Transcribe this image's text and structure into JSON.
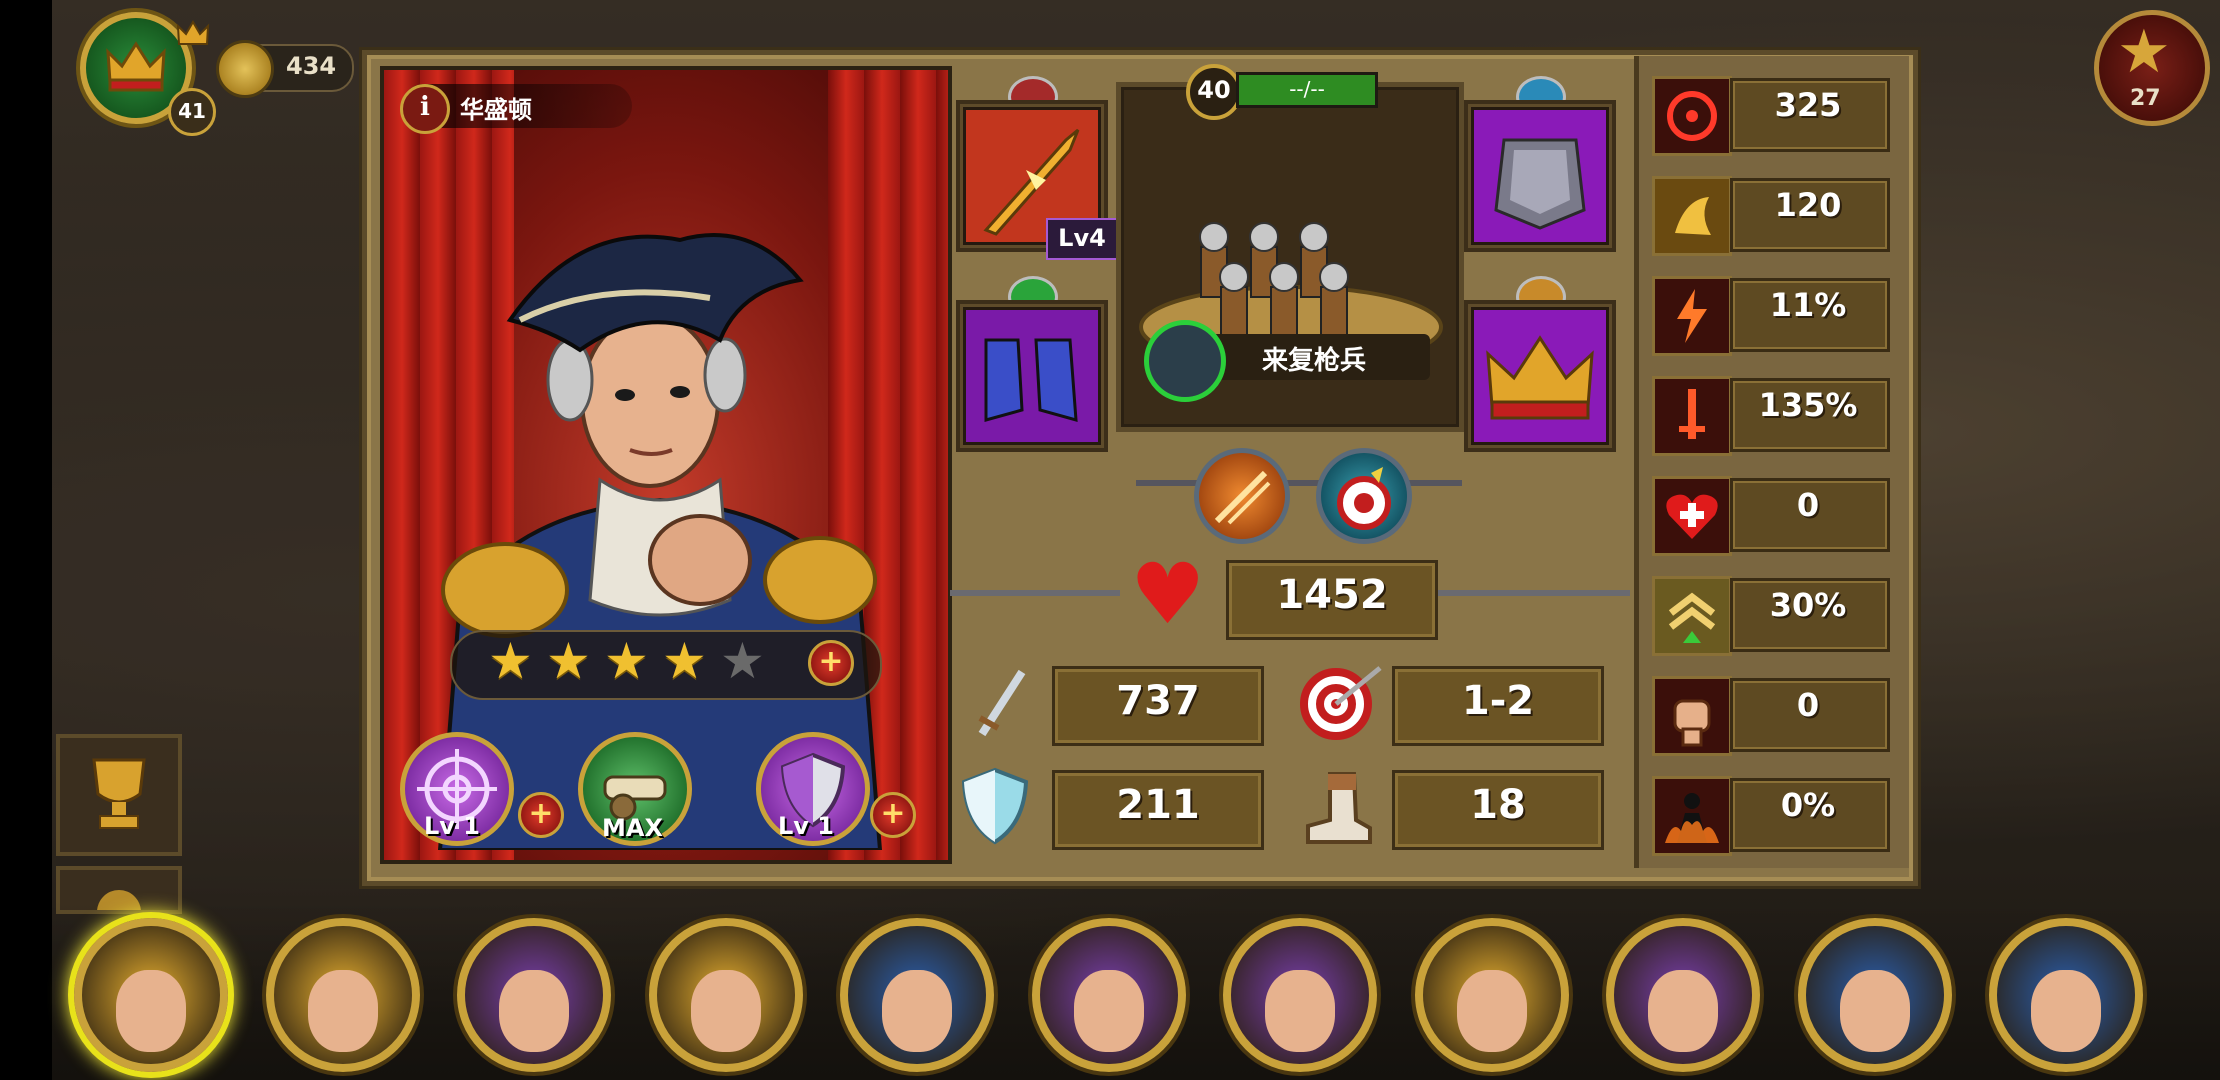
{
  "player": {
    "level": "41",
    "coins": "434"
  },
  "top_right": {
    "count": "27"
  },
  "hero": {
    "name": "华盛顿",
    "stars_total": 5,
    "stars_filled": 4,
    "skills": [
      {
        "name": "target-skill",
        "label": "Lv 1",
        "color": "#9b3fc9"
      },
      {
        "name": "weapon-skill",
        "label": "MAX",
        "color": "#2e8c3a"
      },
      {
        "name": "shield-skill",
        "label": "Lv 1",
        "color": "#9b3fc9"
      }
    ]
  },
  "equipment": {
    "weapon_level": "Lv4"
  },
  "troop": {
    "level": "40",
    "progress_text": "--/--",
    "name": "来复枪兵"
  },
  "stats": {
    "hp": "1452",
    "attack": "737",
    "range": "1-2",
    "defense": "211",
    "speed": "18"
  },
  "attributes": [
    {
      "icon": "crosshair-icon",
      "value": "325"
    },
    {
      "icon": "dodge-icon",
      "value": "120"
    },
    {
      "icon": "critical-icon",
      "value": "11%"
    },
    {
      "icon": "crit-damage-icon",
      "value": "135%"
    },
    {
      "icon": "heal-icon",
      "value": "0"
    },
    {
      "icon": "rank-up-icon",
      "value": "30%"
    },
    {
      "icon": "fist-icon",
      "value": "0"
    },
    {
      "icon": "burn-icon",
      "value": "0%"
    }
  ],
  "hero_roster": [
    {
      "name": "roster-hero-1",
      "color": "#e8b030"
    },
    {
      "name": "roster-hero-2",
      "color": "#e8b030"
    },
    {
      "name": "roster-hero-3",
      "color": "#7a3fb0"
    },
    {
      "name": "roster-hero-4",
      "color": "#e8b030"
    },
    {
      "name": "roster-hero-5",
      "color": "#2a5fb0"
    },
    {
      "name": "roster-hero-6",
      "color": "#7a3fb0"
    },
    {
      "name": "roster-hero-7",
      "color": "#7a3fb0"
    },
    {
      "name": "roster-hero-8",
      "color": "#e8b030"
    },
    {
      "name": "roster-hero-9",
      "color": "#7a3fb0"
    },
    {
      "name": "roster-hero-10",
      "color": "#2a5fb0"
    },
    {
      "name": "roster-hero-11",
      "color": "#2a5fb0"
    }
  ]
}
